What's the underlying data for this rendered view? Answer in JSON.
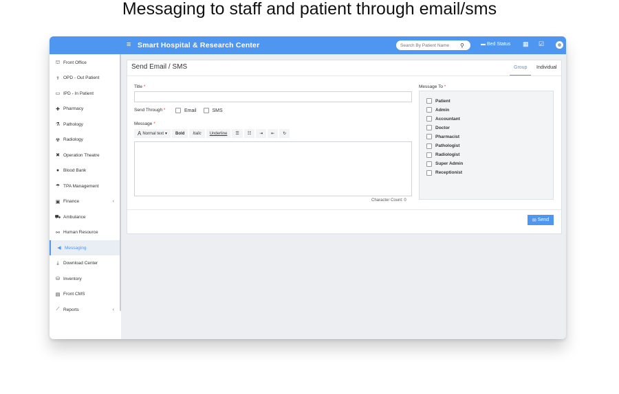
{
  "headline": "Messaging to staff and patient through email/sms",
  "app": {
    "title": "Smart Hospital & Research Center",
    "search_placeholder": "Search By Patient Name",
    "bed_status": "Bed Status"
  },
  "sidebar": {
    "items": [
      {
        "label": "Front Office",
        "icon": "front-office-icon",
        "glyph": "⛫"
      },
      {
        "label": "OPD - Out Patient",
        "icon": "stethoscope-icon",
        "glyph": "⚕"
      },
      {
        "label": "IPD - In Patient",
        "icon": "bed-icon",
        "glyph": "▭"
      },
      {
        "label": "Pharmacy",
        "icon": "pill-icon",
        "glyph": "✚"
      },
      {
        "label": "Pathology",
        "icon": "flask-icon",
        "glyph": "⚗"
      },
      {
        "label": "Radiology",
        "icon": "radiology-icon",
        "glyph": "☢"
      },
      {
        "label": "Operation Theatre",
        "icon": "scissors-icon",
        "glyph": "✖"
      },
      {
        "label": "Blood Bank",
        "icon": "drop-icon",
        "glyph": "●"
      },
      {
        "label": "TPA Management",
        "icon": "umbrella-icon",
        "glyph": "☂"
      },
      {
        "label": "Finance",
        "icon": "money-icon",
        "glyph": "▣",
        "has_chevron": true
      },
      {
        "label": "Ambulance",
        "icon": "ambulance-icon",
        "glyph": "⛟"
      },
      {
        "label": "Human Resource",
        "icon": "sitemap-icon",
        "glyph": "⚯"
      },
      {
        "label": "Messaging",
        "icon": "bullhorn-icon",
        "glyph": "◀",
        "active": true
      },
      {
        "label": "Download Center",
        "icon": "download-icon",
        "glyph": "⤓"
      },
      {
        "label": "Inventory",
        "icon": "inventory-icon",
        "glyph": "⛁"
      },
      {
        "label": "Front CMS",
        "icon": "newspaper-icon",
        "glyph": "▤"
      },
      {
        "label": "Reports",
        "icon": "chart-icon",
        "glyph": "⟋",
        "has_chevron": true
      }
    ],
    "chevron": "‹"
  },
  "panel": {
    "title": "Send Email / SMS",
    "tabs": [
      "Group",
      "Individual"
    ],
    "active_tab": "Group",
    "title_label": "Title",
    "title_value": "",
    "send_through_label": "Send Through",
    "send_options": [
      "Email",
      "SMS"
    ],
    "message_label": "Message",
    "required_mark": "*",
    "toolbar": {
      "format": "Normal text",
      "bold": "Bold",
      "italic": "Italic",
      "underline": "Underline"
    },
    "char_count": "Character Count: 0",
    "message_to_label": "Message To",
    "recipients": [
      "Patient",
      "Admin",
      "Accountant",
      "Doctor",
      "Pharmacist",
      "Pathologist",
      "Radiologist",
      "Super Admin",
      "Receptionist"
    ],
    "send_label": "Send"
  },
  "colors": {
    "accent": "#4f96f1",
    "content_bg": "#eceef2"
  }
}
